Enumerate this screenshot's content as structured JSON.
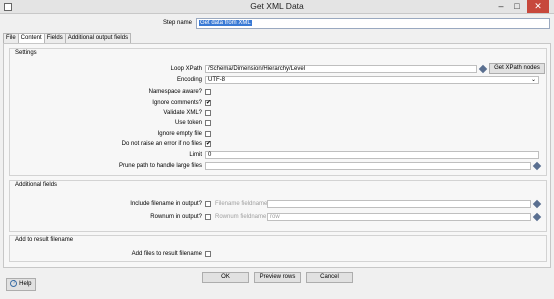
{
  "window": {
    "title": "Get XML Data",
    "minimize_glyph": "–",
    "maximize_glyph": "□",
    "close_glyph": "✕"
  },
  "step": {
    "label": "Step name",
    "value": "Get data from XML"
  },
  "tabs": [
    {
      "label": "File"
    },
    {
      "label": "Content"
    },
    {
      "label": "Fields"
    },
    {
      "label": "Additional output fields"
    }
  ],
  "settings": {
    "title": "Settings",
    "loop_xpath": {
      "label": "Loop XPath",
      "value": "/Schema/Dimension/Hierarchy/Level",
      "button": "Get XPath nodes"
    },
    "encoding": {
      "label": "Encoding",
      "value": "UTF-8"
    },
    "namespace_aware": {
      "label": "Namespace aware?",
      "checked": false
    },
    "ignore_comments": {
      "label": "Ignore comments?",
      "checked": true
    },
    "validate_xml": {
      "label": "Validate XML?",
      "checked": false
    },
    "use_token": {
      "label": "Use token",
      "checked": false
    },
    "ignore_empty_file": {
      "label": "Ignore empty file",
      "checked": false
    },
    "no_error_if_no_files": {
      "label": "Do not raise an error if no files",
      "checked": true
    },
    "limit": {
      "label": "Limit",
      "value": "0"
    },
    "prune_path": {
      "label": "Prune path to handle large files",
      "value": ""
    },
    "check_glyph": "✔"
  },
  "additional_fields": {
    "title": "Additional fields",
    "include_filename": {
      "label": "Include filename in output?",
      "checked": false,
      "field_label": "Filename fieldname",
      "value": ""
    },
    "rownum": {
      "label": "Rownum in output?",
      "checked": false,
      "field_label": "Rownum fieldname",
      "value": "row"
    }
  },
  "result_filename": {
    "title": "Add to result filename",
    "add_files": {
      "label": "Add files to result filename",
      "checked": false
    }
  },
  "buttons": {
    "ok": "OK",
    "preview": "Preview rows",
    "cancel": "Cancel",
    "help": "Help"
  },
  "icons": {
    "variable": "diamond-variable-icon",
    "help": "help-circle-icon",
    "dropdown": "chevron-down-icon"
  }
}
